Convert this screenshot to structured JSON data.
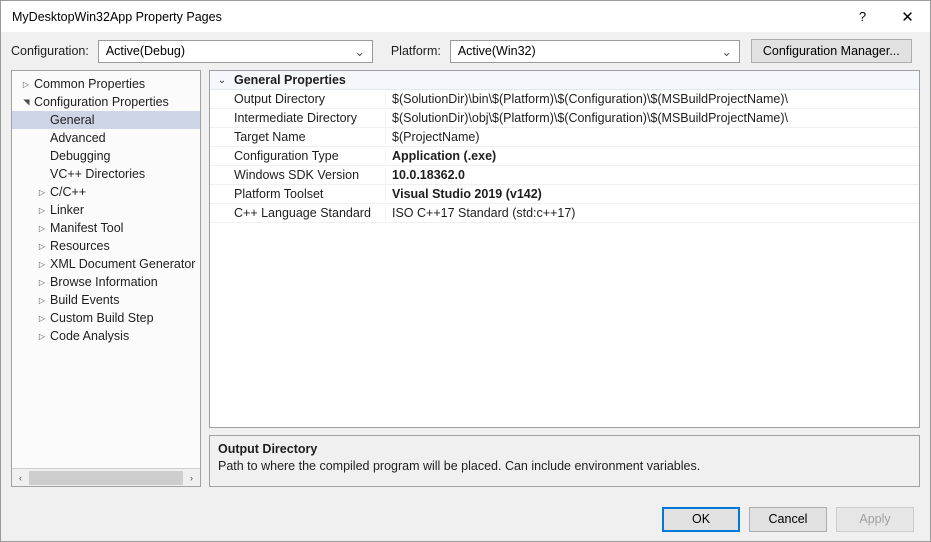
{
  "window": {
    "title": "MyDesktopWin32App Property Pages",
    "help_icon": "?",
    "close_icon": "✕"
  },
  "configbar": {
    "configuration_label": "Configuration:",
    "configuration_value": "Active(Debug)",
    "platform_label": "Platform:",
    "platform_value": "Active(Win32)",
    "config_manager_label": "Configuration Manager...",
    "chevron_icon": "⌄"
  },
  "tree": {
    "items": [
      {
        "label": "Common Properties",
        "indent": 0,
        "expander": "collapsed",
        "selected": false
      },
      {
        "label": "Configuration Properties",
        "indent": 0,
        "expander": "expanded",
        "selected": false
      },
      {
        "label": "General",
        "indent": 1,
        "expander": "none",
        "selected": true
      },
      {
        "label": "Advanced",
        "indent": 1,
        "expander": "none",
        "selected": false
      },
      {
        "label": "Debugging",
        "indent": 1,
        "expander": "none",
        "selected": false
      },
      {
        "label": "VC++ Directories",
        "indent": 1,
        "expander": "none",
        "selected": false
      },
      {
        "label": "C/C++",
        "indent": 1,
        "expander": "collapsed",
        "selected": false
      },
      {
        "label": "Linker",
        "indent": 1,
        "expander": "collapsed",
        "selected": false
      },
      {
        "label": "Manifest Tool",
        "indent": 1,
        "expander": "collapsed",
        "selected": false
      },
      {
        "label": "Resources",
        "indent": 1,
        "expander": "collapsed",
        "selected": false
      },
      {
        "label": "XML Document Generator",
        "indent": 1,
        "expander": "collapsed",
        "selected": false
      },
      {
        "label": "Browse Information",
        "indent": 1,
        "expander": "collapsed",
        "selected": false
      },
      {
        "label": "Build Events",
        "indent": 1,
        "expander": "collapsed",
        "selected": false
      },
      {
        "label": "Custom Build Step",
        "indent": 1,
        "expander": "collapsed",
        "selected": false
      },
      {
        "label": "Code Analysis",
        "indent": 1,
        "expander": "collapsed",
        "selected": false
      }
    ],
    "scrollbar": {
      "left_arrow_icon": "‹",
      "right_arrow_icon": "›"
    }
  },
  "grid": {
    "category": "General Properties",
    "category_chevron_icon": "⌄",
    "rows": [
      {
        "name": "Output Directory",
        "value": "$(SolutionDir)\\bin\\$(Platform)\\$(Configuration)\\$(MSBuildProjectName)\\",
        "bold": false
      },
      {
        "name": "Intermediate Directory",
        "value": "$(SolutionDir)\\obj\\$(Platform)\\$(Configuration)\\$(MSBuildProjectName)\\",
        "bold": false
      },
      {
        "name": "Target Name",
        "value": "$(ProjectName)",
        "bold": false
      },
      {
        "name": "Configuration Type",
        "value": "Application (.exe)",
        "bold": true
      },
      {
        "name": "Windows SDK Version",
        "value": "10.0.18362.0",
        "bold": true
      },
      {
        "name": "Platform Toolset",
        "value": "Visual Studio 2019 (v142)",
        "bold": true
      },
      {
        "name": "C++ Language Standard",
        "value": "ISO C++17 Standard (std:c++17)",
        "bold": false
      }
    ]
  },
  "description": {
    "title": "Output Directory",
    "text": "Path to where the compiled program will be placed. Can include environment variables."
  },
  "footer": {
    "ok_label": "OK",
    "cancel_label": "Cancel",
    "apply_label": "Apply"
  },
  "colors": {
    "accent": "#0078d7",
    "selection": "#cdd5e6",
    "dialog_bg": "#f0f0f0"
  }
}
